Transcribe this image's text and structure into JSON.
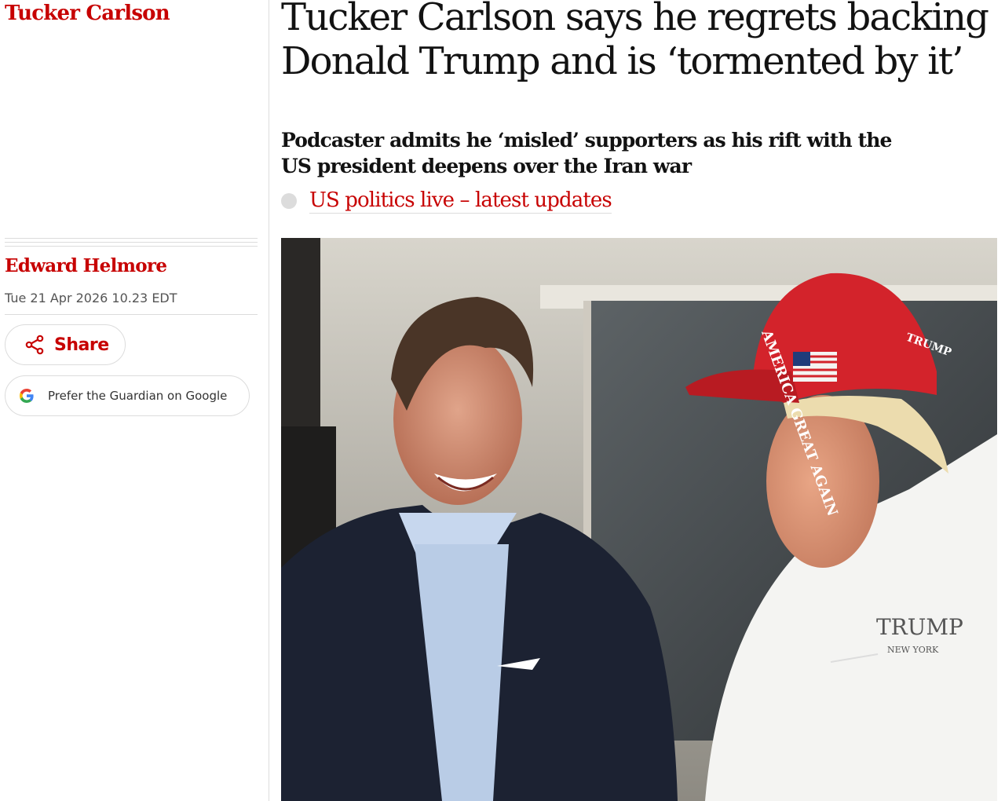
{
  "section_tag": "Tucker Carlson",
  "headline": "Tucker Carlson says he regrets backing Donald Trump and is ‘tormented by it’",
  "standfirst": "Podcaster admits he ‘misled’ supporters as his rift with the US president deepens over the Iran war",
  "live_link": {
    "label": "US politics live – latest updates"
  },
  "byline": {
    "author": "Edward Helmore",
    "date": "Tue 21 Apr 2026 10.23 EDT"
  },
  "buttons": {
    "share_label": "Share",
    "google_label": "Prefer the Guardian on Google"
  },
  "hero_image": {
    "cap_text_front": "AMERICA GREAT AGAIN",
    "cap_text_side": "TRUMP",
    "shirt_logo": "TRUMP",
    "shirt_logo_sub": "NEW YORK"
  },
  "colors": {
    "brand_red": "#c70000",
    "text": "#121212",
    "muted": "#545454",
    "rule": "#dcdcdc"
  },
  "icons": {
    "share": "share-icon",
    "google": "google-g-icon"
  }
}
